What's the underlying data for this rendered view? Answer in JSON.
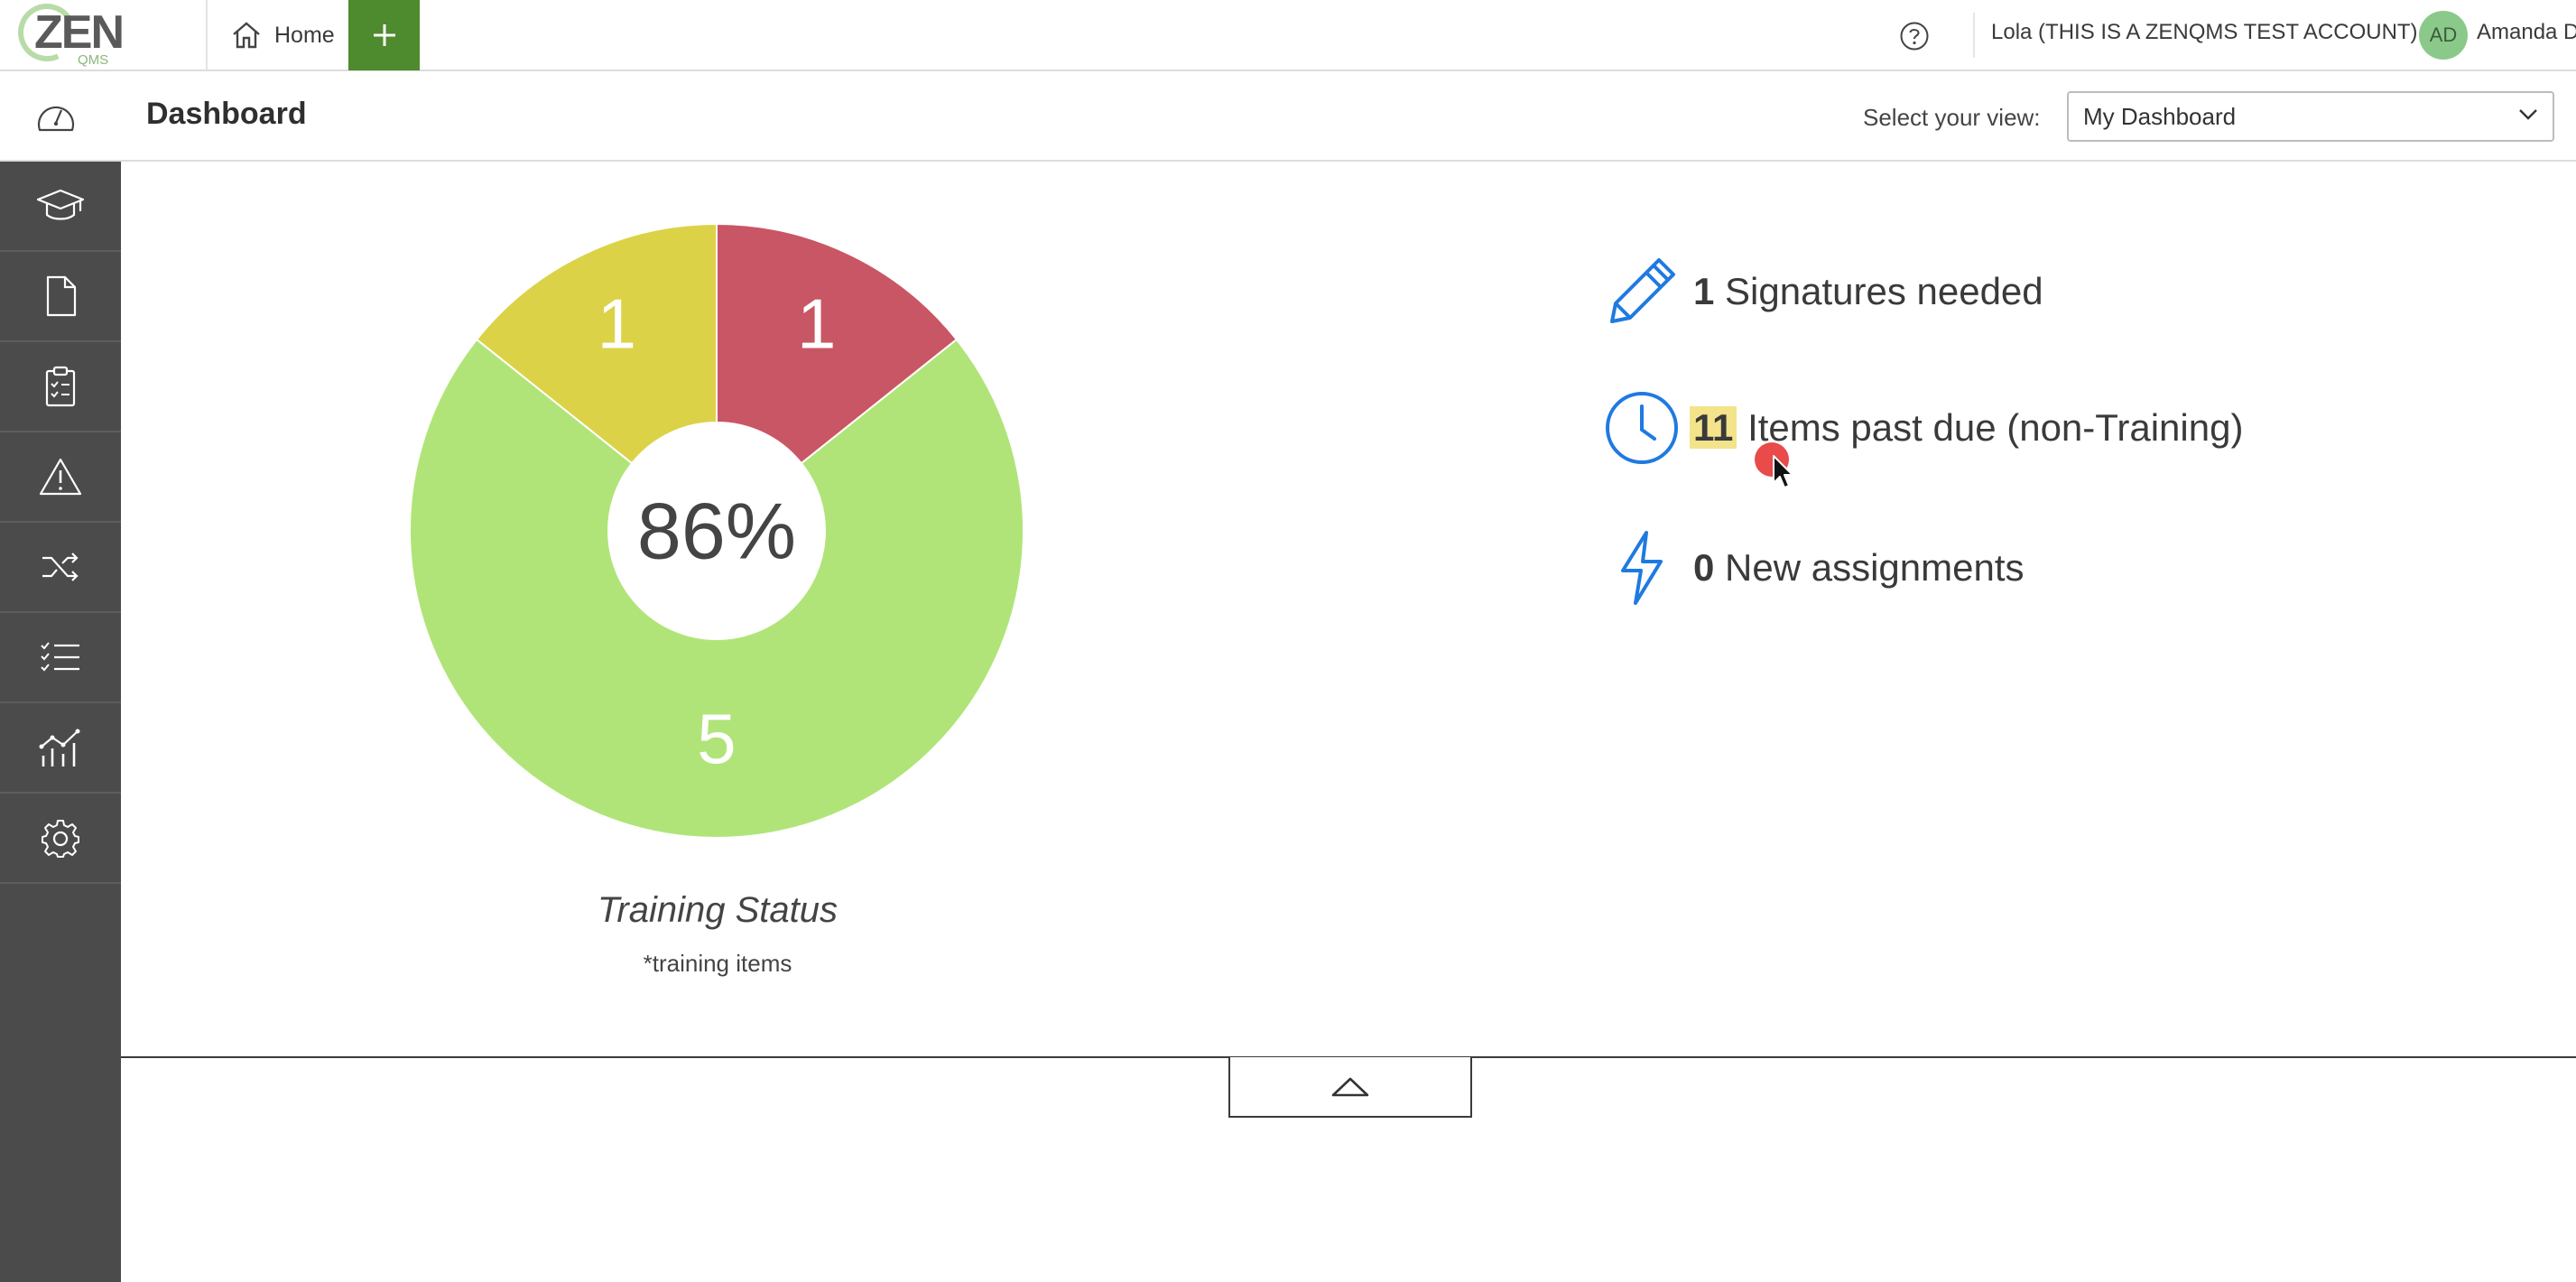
{
  "topbar": {
    "logo_text": "ZEN",
    "logo_sub": "QMS",
    "home_tab_label": "Home",
    "add_label": "+",
    "account_label": "Lola (THIS IS A ZENQMS TEST ACCOUNT)",
    "avatar_initials": "AD",
    "user_name": "Amanda D"
  },
  "subheader": {
    "page_title": "Dashboard",
    "view_label": "Select your view:",
    "view_selected": "My Dashboard"
  },
  "sidebar": {
    "items": [
      "graduation-cap-icon",
      "document-icon",
      "clipboard-checklist-icon",
      "warning-icon",
      "shuffle-icon",
      "checklist-icon",
      "analytics-chart-icon",
      "gear-icon"
    ]
  },
  "training_chart": {
    "center_label": "86%",
    "title": "Training Status",
    "subtitle": "*training items"
  },
  "chart_data": {
    "type": "pie",
    "title": "Training Status",
    "center_label": "86%",
    "slices": [
      {
        "value": 1,
        "color": "#c95664"
      },
      {
        "value": 5,
        "color": "#b0e478"
      },
      {
        "value": 1,
        "color": "#dcd247"
      }
    ]
  },
  "stats": [
    {
      "count": "1",
      "label": "Signatures needed",
      "icon": "pencil-icon"
    },
    {
      "count": "11",
      "label": "Items past due (non-Training)",
      "icon": "clock-icon"
    },
    {
      "count": "0",
      "label": "New assignments",
      "icon": "lightning-icon"
    }
  ],
  "colors": {
    "accent_green": "#4e8a2e",
    "icon_blue": "#1f7ae0",
    "sidebar_bg": "#4b4b4b",
    "highlight": "#f3e38a"
  }
}
